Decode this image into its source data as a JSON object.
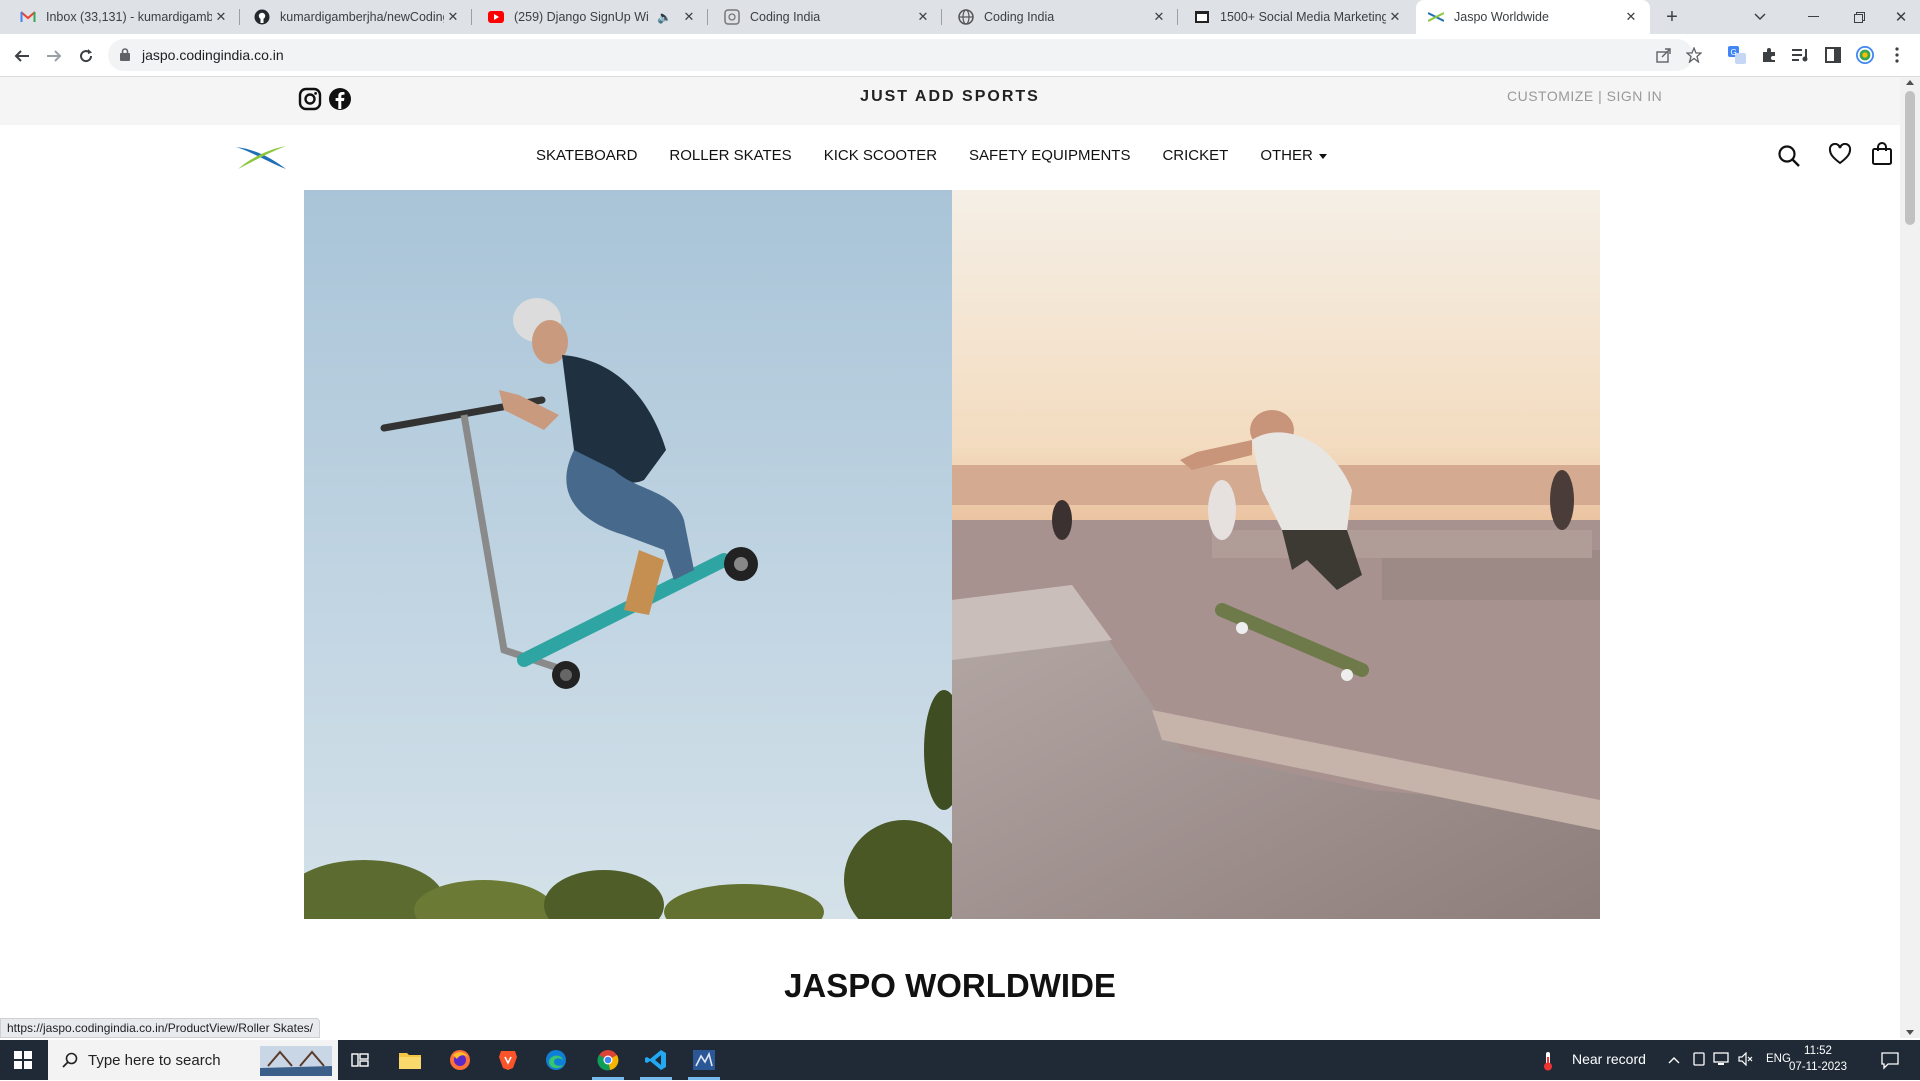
{
  "browser": {
    "tabs": [
      {
        "title": "Inbox (33,131) - kumardigambe",
        "icon": "gmail-icon"
      },
      {
        "title": "kumardigamberjha/newCoding",
        "icon": "github-icon"
      },
      {
        "title": "(259) Django SignUp With",
        "icon": "youtube-icon"
      },
      {
        "title": "Coding India",
        "icon": "globe-icon"
      },
      {
        "title": "Coding India",
        "icon": "globe-icon"
      },
      {
        "title": "1500+ Social Media Marketing",
        "icon": "website-icon"
      },
      {
        "title": "Jaspo Worldwide",
        "icon": "jaspo-icon"
      }
    ],
    "url": "jaspo.codingindia.co.in",
    "status_url": "https://jaspo.codingindia.co.in/ProductView/Roller Skates/"
  },
  "site": {
    "tagline": "JUST ADD SPORTS",
    "account": "CUSTOMIZE | SIGN IN",
    "menu": [
      "SKATEBOARD",
      "ROLLER SKATES",
      "KICK SCOOTER",
      "SAFETY EQUIPMENTS",
      "CRICKET",
      "OTHER"
    ],
    "heading": "JASPO WORLDWIDE",
    "colors": {
      "logo_blue": "#1f6fb5",
      "logo_green": "#8cc63f"
    }
  },
  "taskbar": {
    "search_placeholder": "Type here to search",
    "weather": "Near record",
    "lang": "ENG",
    "time": "11:52",
    "date": "07-11-2023"
  }
}
